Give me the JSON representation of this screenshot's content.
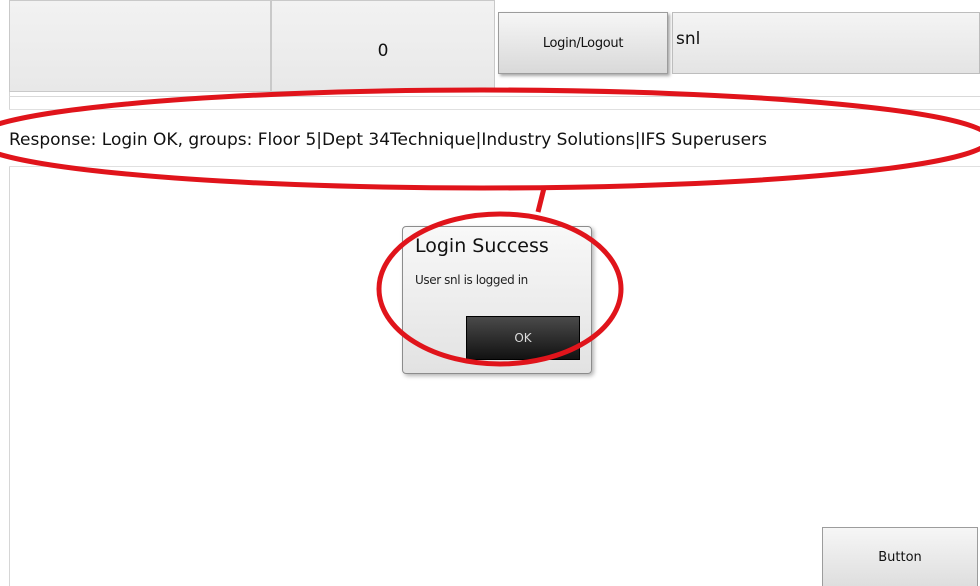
{
  "toolbar": {
    "counter_value": "0",
    "login_button_label": "Login/Logout",
    "user_value": "snl"
  },
  "response": {
    "text": "Response: Login OK, groups: Floor 5|Dept 34Technique|Industry Solutions|IFS Superusers"
  },
  "dialog": {
    "title": "Login Success",
    "message": "User snl is logged in",
    "ok_label": "OK"
  },
  "footer": {
    "button_label": "Button"
  },
  "colors": {
    "annotation_red": "#e0141b",
    "dialog_button_dark": "#121212"
  }
}
